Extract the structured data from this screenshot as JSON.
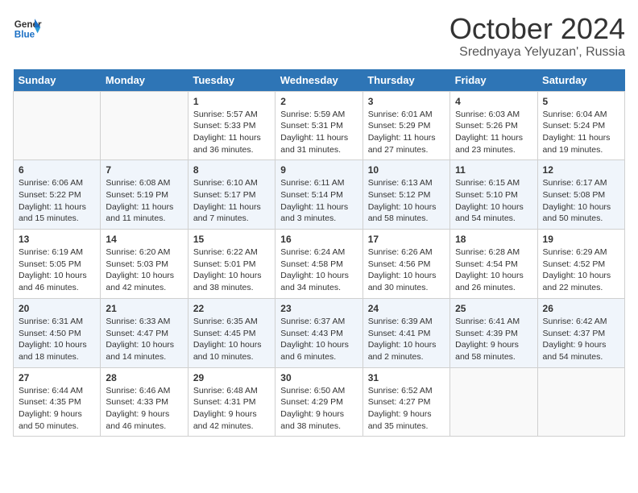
{
  "logo": {
    "general": "General",
    "blue": "Blue"
  },
  "header": {
    "month": "October 2024",
    "location": "Srednyaya Yelyuzan', Russia"
  },
  "days_of_week": [
    "Sunday",
    "Monday",
    "Tuesday",
    "Wednesday",
    "Thursday",
    "Friday",
    "Saturday"
  ],
  "weeks": [
    [
      {
        "day": "",
        "info": ""
      },
      {
        "day": "",
        "info": ""
      },
      {
        "day": "1",
        "info": "Sunrise: 5:57 AM\nSunset: 5:33 PM\nDaylight: 11 hours and 36 minutes."
      },
      {
        "day": "2",
        "info": "Sunrise: 5:59 AM\nSunset: 5:31 PM\nDaylight: 11 hours and 31 minutes."
      },
      {
        "day": "3",
        "info": "Sunrise: 6:01 AM\nSunset: 5:29 PM\nDaylight: 11 hours and 27 minutes."
      },
      {
        "day": "4",
        "info": "Sunrise: 6:03 AM\nSunset: 5:26 PM\nDaylight: 11 hours and 23 minutes."
      },
      {
        "day": "5",
        "info": "Sunrise: 6:04 AM\nSunset: 5:24 PM\nDaylight: 11 hours and 19 minutes."
      }
    ],
    [
      {
        "day": "6",
        "info": "Sunrise: 6:06 AM\nSunset: 5:22 PM\nDaylight: 11 hours and 15 minutes."
      },
      {
        "day": "7",
        "info": "Sunrise: 6:08 AM\nSunset: 5:19 PM\nDaylight: 11 hours and 11 minutes."
      },
      {
        "day": "8",
        "info": "Sunrise: 6:10 AM\nSunset: 5:17 PM\nDaylight: 11 hours and 7 minutes."
      },
      {
        "day": "9",
        "info": "Sunrise: 6:11 AM\nSunset: 5:14 PM\nDaylight: 11 hours and 3 minutes."
      },
      {
        "day": "10",
        "info": "Sunrise: 6:13 AM\nSunset: 5:12 PM\nDaylight: 10 hours and 58 minutes."
      },
      {
        "day": "11",
        "info": "Sunrise: 6:15 AM\nSunset: 5:10 PM\nDaylight: 10 hours and 54 minutes."
      },
      {
        "day": "12",
        "info": "Sunrise: 6:17 AM\nSunset: 5:08 PM\nDaylight: 10 hours and 50 minutes."
      }
    ],
    [
      {
        "day": "13",
        "info": "Sunrise: 6:19 AM\nSunset: 5:05 PM\nDaylight: 10 hours and 46 minutes."
      },
      {
        "day": "14",
        "info": "Sunrise: 6:20 AM\nSunset: 5:03 PM\nDaylight: 10 hours and 42 minutes."
      },
      {
        "day": "15",
        "info": "Sunrise: 6:22 AM\nSunset: 5:01 PM\nDaylight: 10 hours and 38 minutes."
      },
      {
        "day": "16",
        "info": "Sunrise: 6:24 AM\nSunset: 4:58 PM\nDaylight: 10 hours and 34 minutes."
      },
      {
        "day": "17",
        "info": "Sunrise: 6:26 AM\nSunset: 4:56 PM\nDaylight: 10 hours and 30 minutes."
      },
      {
        "day": "18",
        "info": "Sunrise: 6:28 AM\nSunset: 4:54 PM\nDaylight: 10 hours and 26 minutes."
      },
      {
        "day": "19",
        "info": "Sunrise: 6:29 AM\nSunset: 4:52 PM\nDaylight: 10 hours and 22 minutes."
      }
    ],
    [
      {
        "day": "20",
        "info": "Sunrise: 6:31 AM\nSunset: 4:50 PM\nDaylight: 10 hours and 18 minutes."
      },
      {
        "day": "21",
        "info": "Sunrise: 6:33 AM\nSunset: 4:47 PM\nDaylight: 10 hours and 14 minutes."
      },
      {
        "day": "22",
        "info": "Sunrise: 6:35 AM\nSunset: 4:45 PM\nDaylight: 10 hours and 10 minutes."
      },
      {
        "day": "23",
        "info": "Sunrise: 6:37 AM\nSunset: 4:43 PM\nDaylight: 10 hours and 6 minutes."
      },
      {
        "day": "24",
        "info": "Sunrise: 6:39 AM\nSunset: 4:41 PM\nDaylight: 10 hours and 2 minutes."
      },
      {
        "day": "25",
        "info": "Sunrise: 6:41 AM\nSunset: 4:39 PM\nDaylight: 9 hours and 58 minutes."
      },
      {
        "day": "26",
        "info": "Sunrise: 6:42 AM\nSunset: 4:37 PM\nDaylight: 9 hours and 54 minutes."
      }
    ],
    [
      {
        "day": "27",
        "info": "Sunrise: 6:44 AM\nSunset: 4:35 PM\nDaylight: 9 hours and 50 minutes."
      },
      {
        "day": "28",
        "info": "Sunrise: 6:46 AM\nSunset: 4:33 PM\nDaylight: 9 hours and 46 minutes."
      },
      {
        "day": "29",
        "info": "Sunrise: 6:48 AM\nSunset: 4:31 PM\nDaylight: 9 hours and 42 minutes."
      },
      {
        "day": "30",
        "info": "Sunrise: 6:50 AM\nSunset: 4:29 PM\nDaylight: 9 hours and 38 minutes."
      },
      {
        "day": "31",
        "info": "Sunrise: 6:52 AM\nSunset: 4:27 PM\nDaylight: 9 hours and 35 minutes."
      },
      {
        "day": "",
        "info": ""
      },
      {
        "day": "",
        "info": ""
      }
    ]
  ]
}
